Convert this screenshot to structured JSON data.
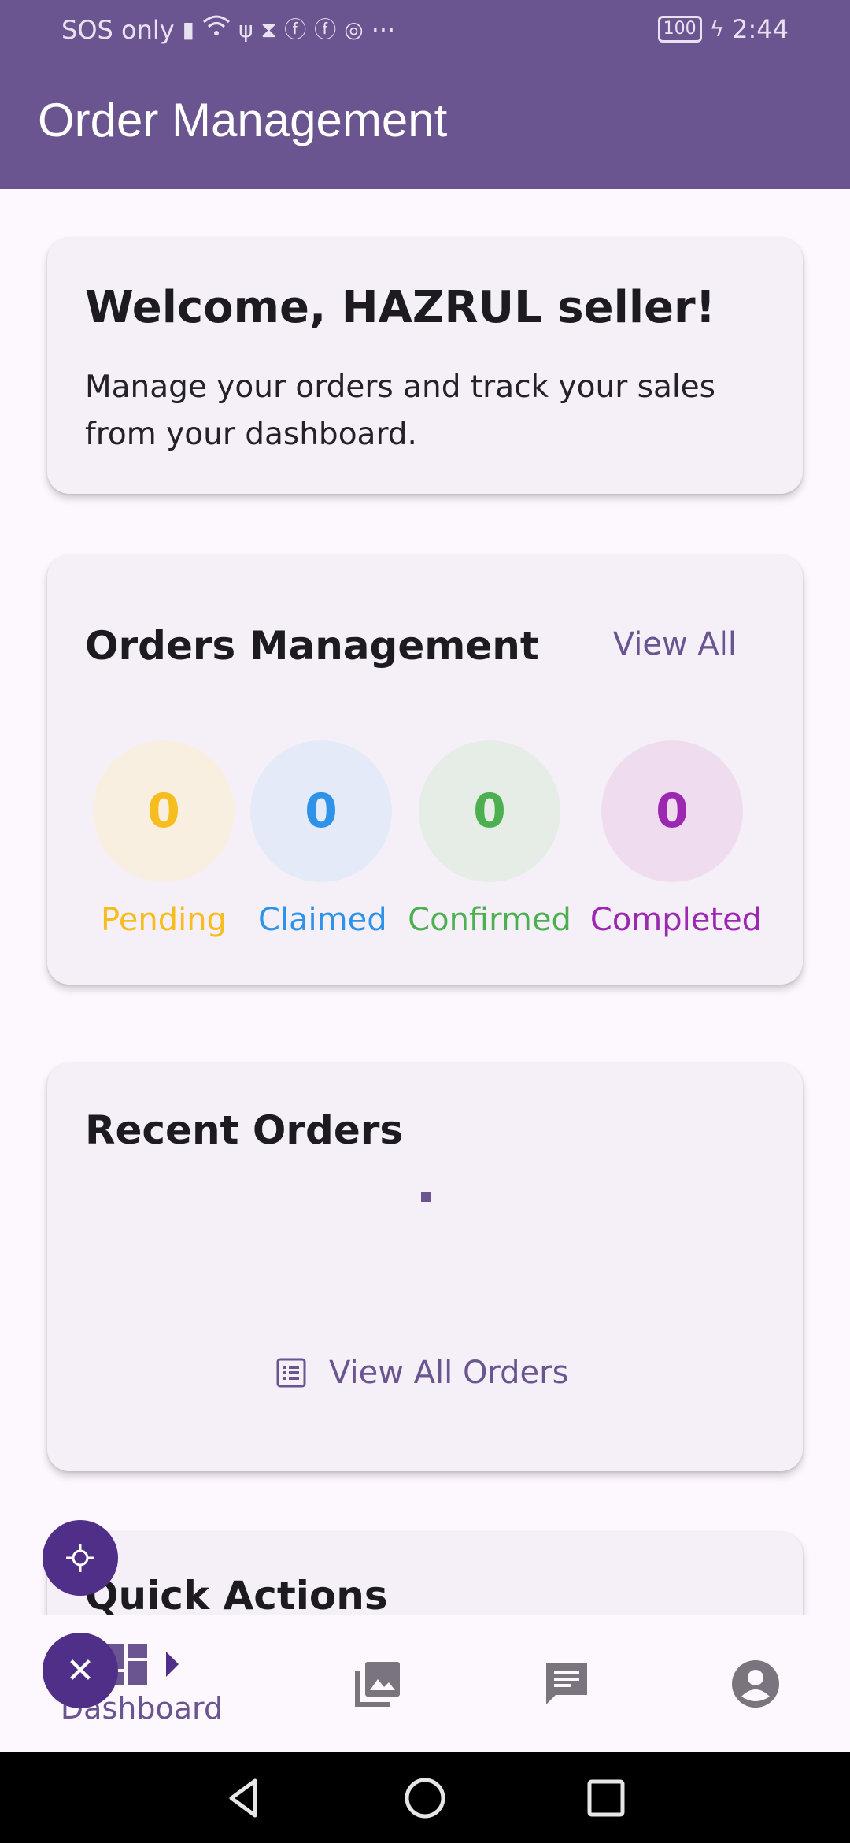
{
  "status_bar": {
    "carrier": "SOS only",
    "more": "···",
    "battery": "100",
    "time": "2:44"
  },
  "app_bar": {
    "title": "Order Management"
  },
  "welcome": {
    "title": "Welcome, HAZRUL seller!",
    "subtitle": "Manage your orders and track your sales from your dashboard."
  },
  "orders_management": {
    "title": "Orders Management",
    "view_all": "View All",
    "stats": [
      {
        "label": "Pending",
        "count": "0",
        "color": "#f7bd1f"
      },
      {
        "label": "Claimed",
        "count": "0",
        "color": "#2e93e8"
      },
      {
        "label": "Confirmed",
        "count": "0",
        "color": "#4caf50"
      },
      {
        "label": "Completed",
        "count": "0",
        "color": "#9c27b0"
      }
    ]
  },
  "recent_orders": {
    "title": "Recent Orders",
    "view_all_orders": "View All Orders"
  },
  "quick_actions": {
    "title": "Quick Actions"
  },
  "bottom_nav": {
    "items": [
      {
        "label": "Dashboard",
        "icon": "dashboard-icon",
        "active": true
      },
      {
        "label": "",
        "icon": "gallery-icon"
      },
      {
        "label": "",
        "icon": "chat-icon"
      },
      {
        "label": "",
        "icon": "account-icon"
      }
    ]
  },
  "colors": {
    "primary": "#6a5590",
    "fab": "#4f2f88",
    "background": "#fdf7fe",
    "card": "#f5f0f8"
  }
}
